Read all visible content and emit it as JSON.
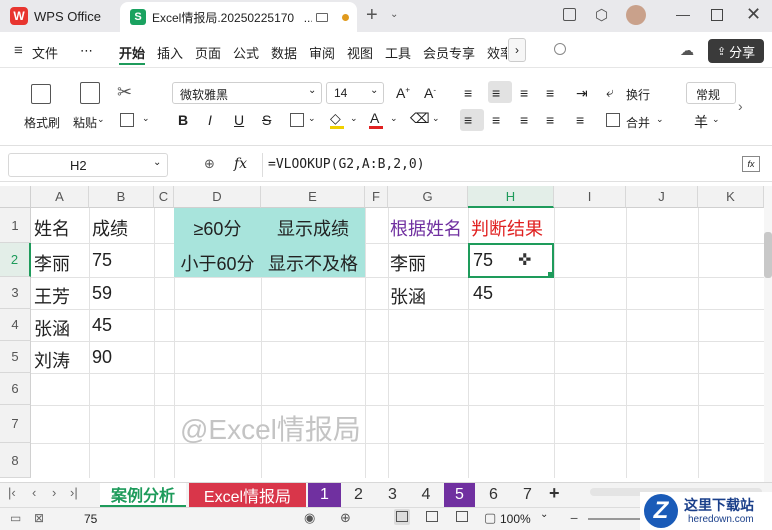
{
  "titlebar": {
    "app_tab": "WPS Office",
    "doc_tab": "Excel情报局.20250225170...",
    "add": "+"
  },
  "menu": {
    "file": "文件",
    "more": "⋯",
    "items": [
      "开始",
      "插入",
      "页面",
      "公式",
      "数据",
      "审阅",
      "视图",
      "工具",
      "会员专享",
      "效率"
    ],
    "share": "分享"
  },
  "ribbon": {
    "format_painter": "格式刷",
    "paste": "粘贴",
    "font_name": "微软雅黑",
    "font_size": "14",
    "bold": "B",
    "italic": "I",
    "underline": "U",
    "strike": "S",
    "wrap": "换行",
    "merge": "合并",
    "number_format": "常规",
    "currency": "羊"
  },
  "formula_bar": {
    "cell_ref": "H2",
    "fx": "fx",
    "formula": "=VLOOKUP(G2,A:B,2,0)"
  },
  "columns": [
    "A",
    "B",
    "C",
    "D",
    "E",
    "F",
    "G",
    "H",
    "I",
    "J",
    "K"
  ],
  "rows": [
    "1",
    "2",
    "3",
    "4",
    "5",
    "6",
    "7",
    "8"
  ],
  "cells": {
    "A1": "姓名",
    "B1": "成绩",
    "A2": "李丽",
    "B2": "75",
    "A3": "王芳",
    "B3": "59",
    "A4": "张涵",
    "B4": "45",
    "A5": "刘涛",
    "B5": "90",
    "D1": "≥60分",
    "E1": "显示成绩",
    "D2": "小于60分",
    "E2": "显示不及格",
    "G1": "根据姓名",
    "H1": "判断结果",
    "G2": "李丽",
    "H2": "75",
    "G3": "张涵",
    "H3": "45"
  },
  "watermark": "@Excel情报局",
  "sheets": [
    "案例分析",
    "Excel情报局",
    "1",
    "2",
    "3",
    "4",
    "5",
    "6",
    "7"
  ],
  "status": {
    "value": "75",
    "zoom": "100%"
  },
  "site_logo": {
    "name": "这里下载站",
    "url": "heredown.com"
  },
  "colors": {
    "teal": "#a8e4dc",
    "purple": "#7030a0",
    "red": "#e02020",
    "selection": "#1e9b5b",
    "sheet_red": "#d9364a"
  }
}
